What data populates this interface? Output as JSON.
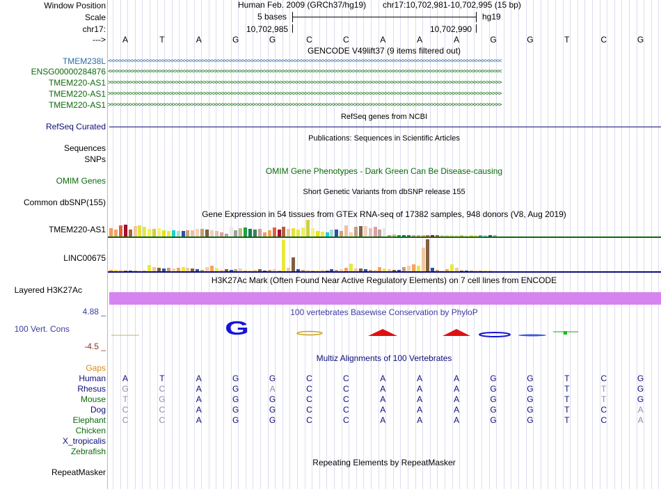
{
  "labels": {
    "window_position": "Window Position",
    "scale": "Scale",
    "chrom": "chr17:",
    "arrow": "--->",
    "tmem238l": "TMEM238L",
    "ensg": "ENSG00000284876",
    "tmem220_1": "TMEM220-AS1",
    "tmem220_2": "TMEM220-AS1",
    "tmem220_3": "TMEM220-AS1",
    "refseq": "RefSeq Curated",
    "sequences": "Sequences",
    "snps": "SNPs",
    "omim_genes": "OMIM Genes",
    "common_dbsnp": "Common dbSNP(155)",
    "gtex_tmem220": "TMEM220-AS1",
    "gtex_linc": "LINC00675",
    "layered": "Layered H3K27Ac",
    "phylop_max": "4.88 _",
    "vert_cons": "100 Vert. Cons",
    "phylop_min": "-4.5 _",
    "gaps": "Gaps",
    "human": "Human",
    "rhesus": "Rhesus",
    "mouse": "Mouse",
    "dog": "Dog",
    "elephant": "Elephant",
    "chicken": "Chicken",
    "x_tropicalis": "X_tropicalis",
    "zebrafish": "Zebrafish",
    "repeatmasker": "RepeatMasker"
  },
  "header": {
    "assembly": "Human Feb. 2009 (GRCh37/hg19)",
    "position": "chr17:10,702,981-10,702,995 (15 bp)",
    "scale_text": "5 bases",
    "db": "hg19",
    "coord1": "10,702,985",
    "coord2": "10,702,990"
  },
  "bases": [
    "A",
    "T",
    "A",
    "G",
    "G",
    "C",
    "C",
    "A",
    "A",
    "A",
    "G",
    "G",
    "T",
    "C",
    "G"
  ],
  "titles": {
    "gencode": "GENCODE V49lift37 (9 items filtered out)",
    "refseq": "RefSeq genes from NCBI",
    "publications": "Publications: Sequences in Scientific Articles",
    "omim": "OMIM Gene Phenotypes - Dark Green Can Be Disease-causing",
    "dbsnp": "Short Genetic Variants from dbSNP release 155",
    "gtex": "Gene Expression in 54 tissues from GTEx RNA-seq of 17382 samples, 948 donors (V8, Aug 2019)",
    "h3k27ac": "H3K27Ac Mark (Often Found Near Active Regulatory Elements) on 7 cell lines from ENCODE",
    "phylop": "100 vertebrates Basewise Conservation by PhyloP",
    "multiz": "Multiz Alignments of 100 Vertebrates",
    "repeatmasker": "Repeating Elements by RepeatMasker"
  },
  "gene_arrows": {
    "left": "<<<<<<<<<<<<<<<<<<<<<<<<<<<<<<<<<<<<<<<<<<<<<<<<<<<<<<<<<<<<<<<<<<<<<<<<<<<<<<<<<<<<<<<<<<<<<<<<<<<<<<<<<<<<<<<<<<<<<<<<<<<<<<<<",
    "right": ">>>>>>>>>>>>>>>>>>>>>>>>>>>>>>>>>>>>>>>>>>>>>>>>>>>>>>>>>>>>>>>>>>>>>>>>>>>>>>>>>>>>>>>>>>>>>>>>>>>>>>>>>>>>>>>>>>>>>>>>>>>>>>>>"
  },
  "alignment": {
    "Rhesus": [
      "G",
      "C",
      "A",
      "G",
      "A",
      "C",
      "C",
      "A",
      "A",
      "A",
      "G",
      "G",
      "T",
      "T",
      "G"
    ],
    "Mouse": [
      "T",
      "G",
      "A",
      "G",
      "G",
      "C",
      "C",
      "A",
      "A",
      "A",
      "G",
      "G",
      "T",
      "T",
      "G"
    ],
    "Dog": [
      "C",
      "C",
      "A",
      "G",
      "G",
      "C",
      "C",
      "A",
      "A",
      "A",
      "G",
      "G",
      "T",
      "C",
      "A"
    ],
    "Elephant": [
      "C",
      "C",
      "A",
      "G",
      "G",
      "C",
      "C",
      "A",
      "A",
      "A",
      "G",
      "G",
      "T",
      "C",
      "A"
    ]
  },
  "colors": {
    "gene_blue": "#2a6ca3",
    "gene_green": "#0a6a0a",
    "navy": "#0c0c78",
    "h3k27ac": "#d685f0",
    "phylop_max": "#3c3ca0",
    "phylop_min": "#8b2f1f",
    "gaps": "#d98a14",
    "dim_base": "#8c8cb0"
  }
}
